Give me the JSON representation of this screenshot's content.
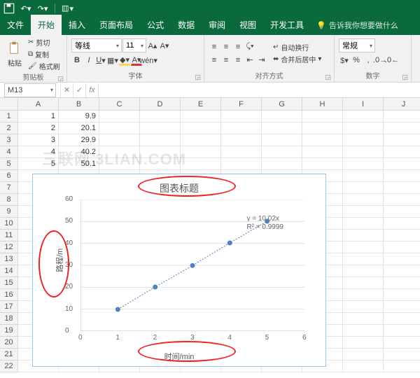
{
  "qat": {
    "tips": [
      "save",
      "undo",
      "redo",
      "touch"
    ]
  },
  "tabs": {
    "items": [
      "文件",
      "开始",
      "插入",
      "页面布局",
      "公式",
      "数据",
      "审阅",
      "视图",
      "开发工具"
    ],
    "active": 1,
    "tell_me": "告诉我你想要做什么"
  },
  "ribbon": {
    "clipboard": {
      "paste": "粘贴",
      "cut": "剪切",
      "copy": "复制",
      "painter": "格式刷",
      "label": "剪贴板"
    },
    "font": {
      "name": "等线",
      "size": "11",
      "label": "字体"
    },
    "alignment": {
      "wrap": "自动换行",
      "merge": "合并后居中",
      "label": "对齐方式"
    },
    "number": {
      "format": "常规",
      "label": "数字"
    }
  },
  "namebox": "M13",
  "columns": [
    "A",
    "B",
    "C",
    "D",
    "E",
    "F",
    "G",
    "H",
    "I",
    "J"
  ],
  "row_count": 22,
  "table": {
    "rows": [
      {
        "a": "1",
        "b": "9.9"
      },
      {
        "a": "2",
        "b": "20.1"
      },
      {
        "a": "3",
        "b": "29.9"
      },
      {
        "a": "4",
        "b": "40.2"
      },
      {
        "a": "5",
        "b": "50.1"
      }
    ]
  },
  "chart_data": {
    "type": "scatter",
    "title": "图表标题",
    "xlabel": "时间/min",
    "ylabel": "路程/m",
    "xlim": [
      0,
      6
    ],
    "ylim": [
      0,
      60
    ],
    "xticks": [
      0,
      1,
      2,
      3,
      4,
      5,
      6
    ],
    "yticks": [
      0,
      10,
      20,
      30,
      40,
      50,
      60
    ],
    "x": [
      1,
      2,
      3,
      4,
      5
    ],
    "y": [
      9.9,
      20.1,
      29.9,
      40.2,
      50.1
    ],
    "trendline": {
      "equation": "y = 10.02x",
      "r2": "R² = 0.9999"
    }
  },
  "watermark": "三联网 3LIAN.COM"
}
